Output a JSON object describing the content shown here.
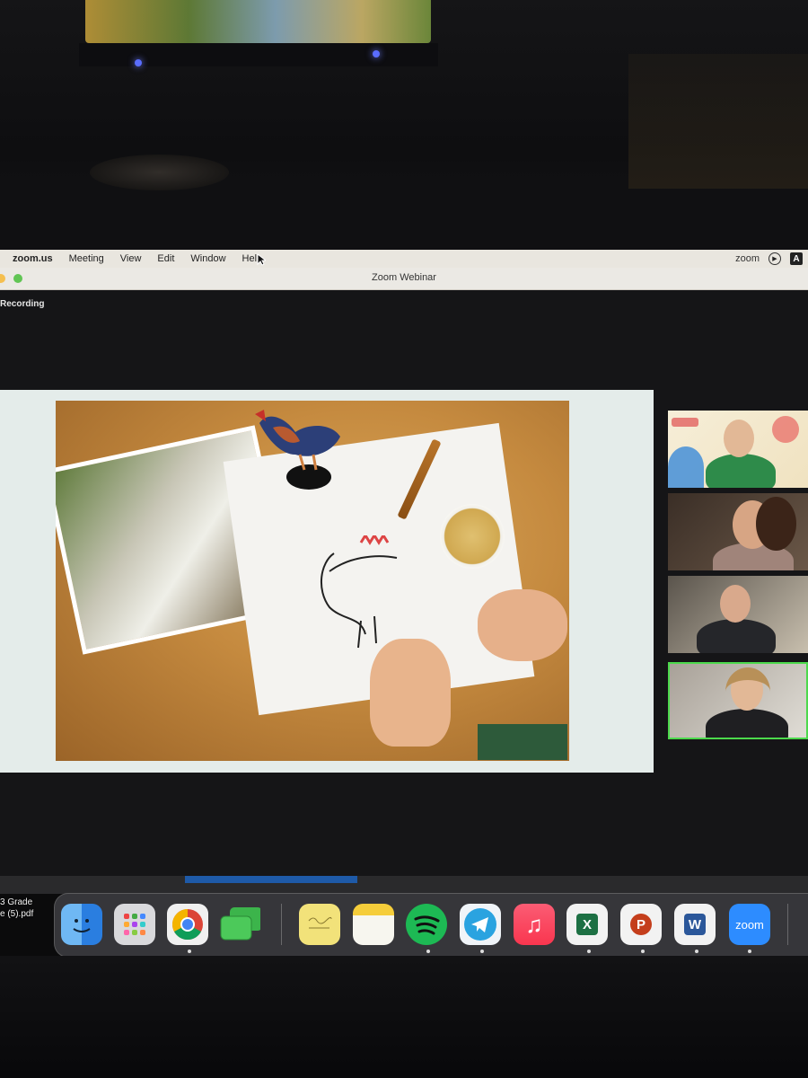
{
  "menubar": {
    "app_name": "zoom.us",
    "menus": [
      "Meeting",
      "View",
      "Edit",
      "Window",
      "Help"
    ],
    "right_logo": "zoom",
    "right_letter": "A"
  },
  "window": {
    "title": "Zoom Webinar",
    "status": "Recording"
  },
  "share": {
    "content_description": "shared screen"
  },
  "participants": [
    {
      "tile": "presenter-1",
      "active": false
    },
    {
      "tile": "presenter-2",
      "active": false
    },
    {
      "tile": "presenter-3",
      "active": false
    },
    {
      "tile": "presenter-4",
      "active": true
    }
  ],
  "dock": {
    "file_label_line1": "3 Grade",
    "file_label_line2": "e (5).pdf",
    "apps": [
      {
        "name": "finder-icon"
      },
      {
        "name": "launchpad-icon"
      },
      {
        "name": "chrome-icon"
      },
      {
        "name": "messages-icon"
      },
      {
        "name": "stickies-icon"
      },
      {
        "name": "notes-icon"
      },
      {
        "name": "spotify-icon"
      },
      {
        "name": "telegram-icon"
      },
      {
        "name": "music-icon"
      },
      {
        "name": "excel-icon",
        "label": "X"
      },
      {
        "name": "powerpoint-icon",
        "label": "P"
      },
      {
        "name": "word-icon",
        "label": "W"
      },
      {
        "name": "zoom-icon",
        "label": "zoom"
      }
    ]
  },
  "colors": {
    "active_speaker": "#4cd94c",
    "zoom_blue": "#2d8cff",
    "recording_bg": "#151517"
  }
}
